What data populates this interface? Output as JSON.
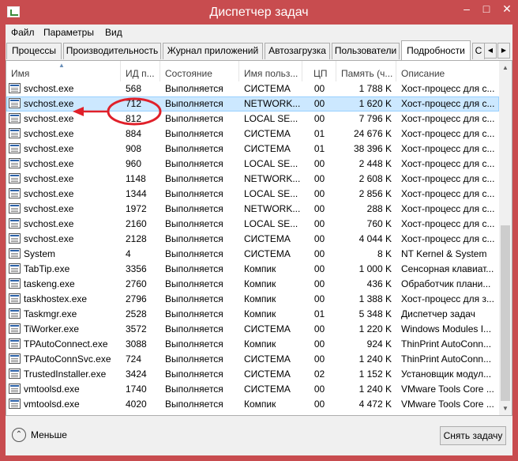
{
  "window": {
    "title": "Диспетчер задач",
    "min": "–",
    "max": "□",
    "close": "✕"
  },
  "menu": [
    "Файл",
    "Параметры",
    "Вид"
  ],
  "tabs": [
    "Процессы",
    "Производительность",
    "Журнал приложений",
    "Автозагрузка",
    "Пользователи",
    "Подробности",
    "С"
  ],
  "tab_scroll": {
    "left": "◀",
    "right": "▶"
  },
  "columns": [
    "Имя",
    "ИД п...",
    "Состояние",
    "Имя польз...",
    "ЦП",
    "Память (ч...",
    "Описание"
  ],
  "sort_arrow": "▲",
  "selected_row": 1,
  "rows": [
    {
      "name": "svchost.exe",
      "pid": "568",
      "state": "Выполняется",
      "user": "СИСТЕМА",
      "cpu": "00",
      "mem": "1 788 K",
      "desc": "Хост-процесс для с...",
      "icon": "service-window-icon"
    },
    {
      "name": "svchost.exe",
      "pid": "712",
      "state": "Выполняется",
      "user": "NETWORK...",
      "cpu": "00",
      "mem": "1 620 K",
      "desc": "Хост-процесс для с...",
      "icon": "service-window-icon"
    },
    {
      "name": "svchost.exe",
      "pid": "812",
      "state": "Выполняется",
      "user": "LOCAL SE...",
      "cpu": "00",
      "mem": "7 796 K",
      "desc": "Хост-процесс для с...",
      "icon": "service-window-icon"
    },
    {
      "name": "svchost.exe",
      "pid": "884",
      "state": "Выполняется",
      "user": "СИСТЕМА",
      "cpu": "01",
      "mem": "24 676 K",
      "desc": "Хост-процесс для с...",
      "icon": "service-window-icon"
    },
    {
      "name": "svchost.exe",
      "pid": "908",
      "state": "Выполняется",
      "user": "СИСТЕМА",
      "cpu": "01",
      "mem": "38 396 K",
      "desc": "Хост-процесс для с...",
      "icon": "service-window-icon"
    },
    {
      "name": "svchost.exe",
      "pid": "960",
      "state": "Выполняется",
      "user": "LOCAL SE...",
      "cpu": "00",
      "mem": "2 448 K",
      "desc": "Хост-процесс для с...",
      "icon": "service-window-icon"
    },
    {
      "name": "svchost.exe",
      "pid": "1148",
      "state": "Выполняется",
      "user": "NETWORK...",
      "cpu": "00",
      "mem": "2 608 K",
      "desc": "Хост-процесс для с...",
      "icon": "service-window-icon"
    },
    {
      "name": "svchost.exe",
      "pid": "1344",
      "state": "Выполняется",
      "user": "LOCAL SE...",
      "cpu": "00",
      "mem": "2 856 K",
      "desc": "Хост-процесс для с...",
      "icon": "service-window-icon"
    },
    {
      "name": "svchost.exe",
      "pid": "1972",
      "state": "Выполняется",
      "user": "NETWORK...",
      "cpu": "00",
      "mem": "288 K",
      "desc": "Хост-процесс для с...",
      "icon": "service-window-icon"
    },
    {
      "name": "svchost.exe",
      "pid": "2160",
      "state": "Выполняется",
      "user": "LOCAL SE...",
      "cpu": "00",
      "mem": "760 K",
      "desc": "Хост-процесс для с...",
      "icon": "service-window-icon"
    },
    {
      "name": "svchost.exe",
      "pid": "2128",
      "state": "Выполняется",
      "user": "СИСТЕМА",
      "cpu": "00",
      "mem": "4 044 K",
      "desc": "Хост-процесс для с...",
      "icon": "service-window-icon"
    },
    {
      "name": "System",
      "pid": "4",
      "state": "Выполняется",
      "user": "СИСТЕМА",
      "cpu": "00",
      "mem": "8 K",
      "desc": "NT Kernel & System",
      "icon": "service-window-icon"
    },
    {
      "name": "TabTip.exe",
      "pid": "3356",
      "state": "Выполняется",
      "user": "Компик",
      "cpu": "00",
      "mem": "1 000 K",
      "desc": "Сенсорная клавиат...",
      "icon": "keyboard-icon"
    },
    {
      "name": "taskeng.exe",
      "pid": "2760",
      "state": "Выполняется",
      "user": "Компик",
      "cpu": "00",
      "mem": "436 K",
      "desc": "Обработчик плани...",
      "icon": "service-window-icon"
    },
    {
      "name": "taskhostex.exe",
      "pid": "2796",
      "state": "Выполняется",
      "user": "Компик",
      "cpu": "00",
      "mem": "1 388 K",
      "desc": "Хост-процесс для з...",
      "icon": "service-window-icon"
    },
    {
      "name": "Taskmgr.exe",
      "pid": "2528",
      "state": "Выполняется",
      "user": "Компик",
      "cpu": "01",
      "mem": "5 348 K",
      "desc": "Диспетчер задач",
      "icon": "task-manager-icon"
    },
    {
      "name": "TiWorker.exe",
      "pid": "3572",
      "state": "Выполняется",
      "user": "СИСТЕМА",
      "cpu": "00",
      "mem": "1 220 K",
      "desc": "Windows Modules I...",
      "icon": "service-window-icon"
    },
    {
      "name": "TPAutoConnect.exe",
      "pid": "3088",
      "state": "Выполняется",
      "user": "Компик",
      "cpu": "00",
      "mem": "924 K",
      "desc": "ThinPrint AutoConn...",
      "icon": "thinprint-icon"
    },
    {
      "name": "TPAutoConnSvc.exe",
      "pid": "724",
      "state": "Выполняется",
      "user": "СИСТЕМА",
      "cpu": "00",
      "mem": "1 240 K",
      "desc": "ThinPrint AutoConn...",
      "icon": "thinprint-icon"
    },
    {
      "name": "TrustedInstaller.exe",
      "pid": "3424",
      "state": "Выполняется",
      "user": "СИСТЕМА",
      "cpu": "02",
      "mem": "1 152 K",
      "desc": "Установщик модул...",
      "icon": "service-window-icon"
    },
    {
      "name": "vmtoolsd.exe",
      "pid": "1740",
      "state": "Выполняется",
      "user": "СИСТЕМА",
      "cpu": "00",
      "mem": "1 240 K",
      "desc": "VMware Tools Core ...",
      "icon": "vmware-icon"
    },
    {
      "name": "vmtoolsd.exe",
      "pid": "4020",
      "state": "Выполняется",
      "user": "Компик",
      "cpu": "00",
      "mem": "4 472 K",
      "desc": "VMware Tools Core ...",
      "icon": "vmware-icon"
    }
  ],
  "scroll": {
    "up": "▲",
    "down": "▼"
  },
  "footer": {
    "less_icon": "⌃",
    "less_label": "Меньше",
    "end_task": "Снять задачу"
  },
  "colors": {
    "titlebar": "#c84c4f",
    "selected_row": "#cce8ff",
    "annotation": "#e0202a"
  }
}
